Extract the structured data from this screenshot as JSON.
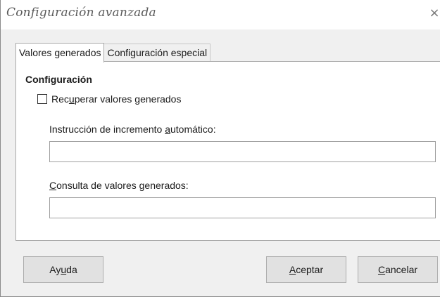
{
  "window": {
    "title": "Configuración avanzada",
    "close_glyph": "×"
  },
  "tabs": [
    {
      "label": "Valores generados",
      "active": true
    },
    {
      "label": "Configuración especial",
      "active": false
    }
  ],
  "section": {
    "heading": "Configuración"
  },
  "checkbox": {
    "label_pre": "Rec",
    "label_mn": "u",
    "label_post": "perar valores generados",
    "checked": false
  },
  "field_auto": {
    "label_pre": "Instrucción de incremento ",
    "label_mn": "a",
    "label_post": "utomático:",
    "value": ""
  },
  "field_query": {
    "label_pre": "",
    "label_mn": "C",
    "label_post": "onsulta de valores generados:",
    "value": ""
  },
  "buttons": {
    "help": {
      "pre": "Ay",
      "mn": "u",
      "post": "da"
    },
    "ok": {
      "pre": "",
      "mn": "A",
      "post": "ceptar"
    },
    "cancel": {
      "pre": "",
      "mn": "C",
      "post": "ancelar"
    }
  },
  "icons": {
    "close": "close-icon"
  }
}
